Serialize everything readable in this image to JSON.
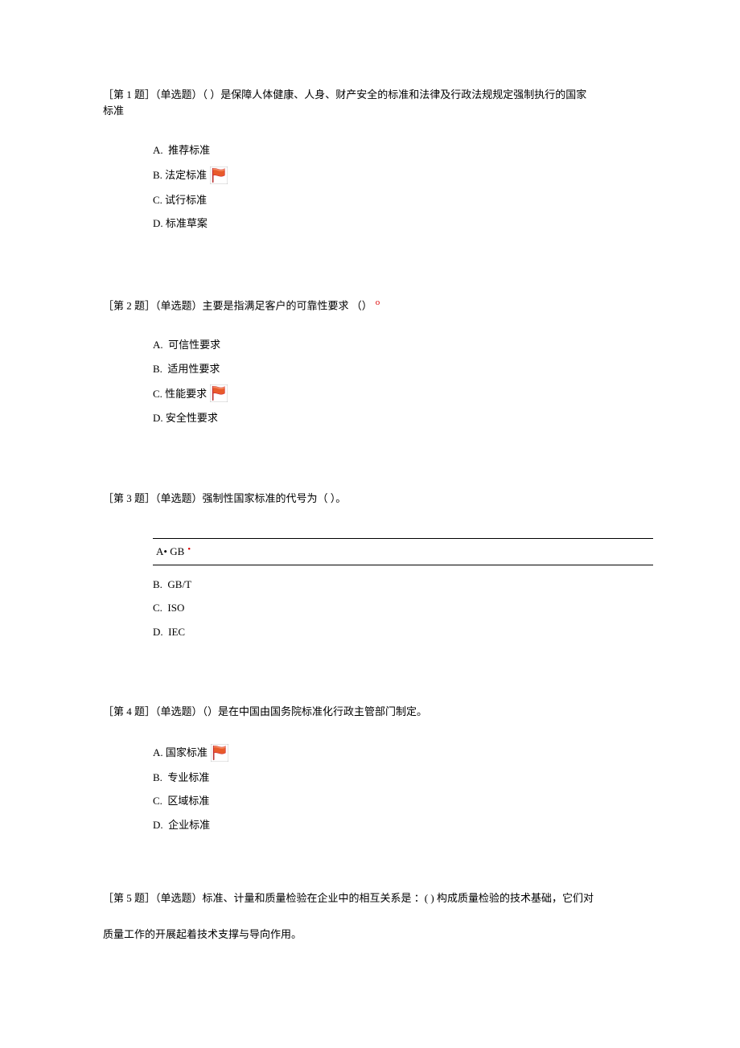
{
  "q1": {
    "label": "［第 1 题］",
    "type": "（单选题）",
    "stem_part1": "（ ）是保障人体健康、人身、财产安全的标准和法律及行政法规规定强制执行的国家",
    "stem_part2": "标准",
    "options": {
      "a": "A.  推荐标准",
      "b": "B. 法定标准",
      "c": "C. 试行标准",
      "d": "D. 标准草案"
    }
  },
  "q2": {
    "label": "［第 2 题］",
    "type": "（单选题）",
    "stem": "主要是指满足客户的可靠性要求    （）",
    "options": {
      "a": "A.  可信性要求",
      "b": "B.  适用性要求",
      "c": "C. 性能要求",
      "d": "D. 安全性要求"
    }
  },
  "q3": {
    "label": "［第 3 题］",
    "type": "（单选题）",
    "stem": "强制性国家标准的代号为（    ）。",
    "options": {
      "a": "A• GB",
      "b": "B.  GB/T",
      "c": "C.  ISO",
      "d": "D.  IEC"
    }
  },
  "q4": {
    "label": "［第 4 题］",
    "type": "（单选题）",
    "stem": "（）是在中国由国务院标准化行政主管部门制定。",
    "options": {
      "a": "A. 国家标准",
      "b": "B.  专业标准",
      "c": "C.  区域标准",
      "d": "D.  企业标准"
    }
  },
  "q5": {
    "label": "［第 5 题］",
    "type": "（单选题）",
    "stem_part1": "标准、计量和质量检验在企业中的相互关系是  ：( ) 构成质量检验的技术基础，它们对",
    "stem_part2": "质量工作的开展起着技术支撑与导向作用。"
  },
  "marks": {
    "circle": "o",
    "dot": "•"
  }
}
